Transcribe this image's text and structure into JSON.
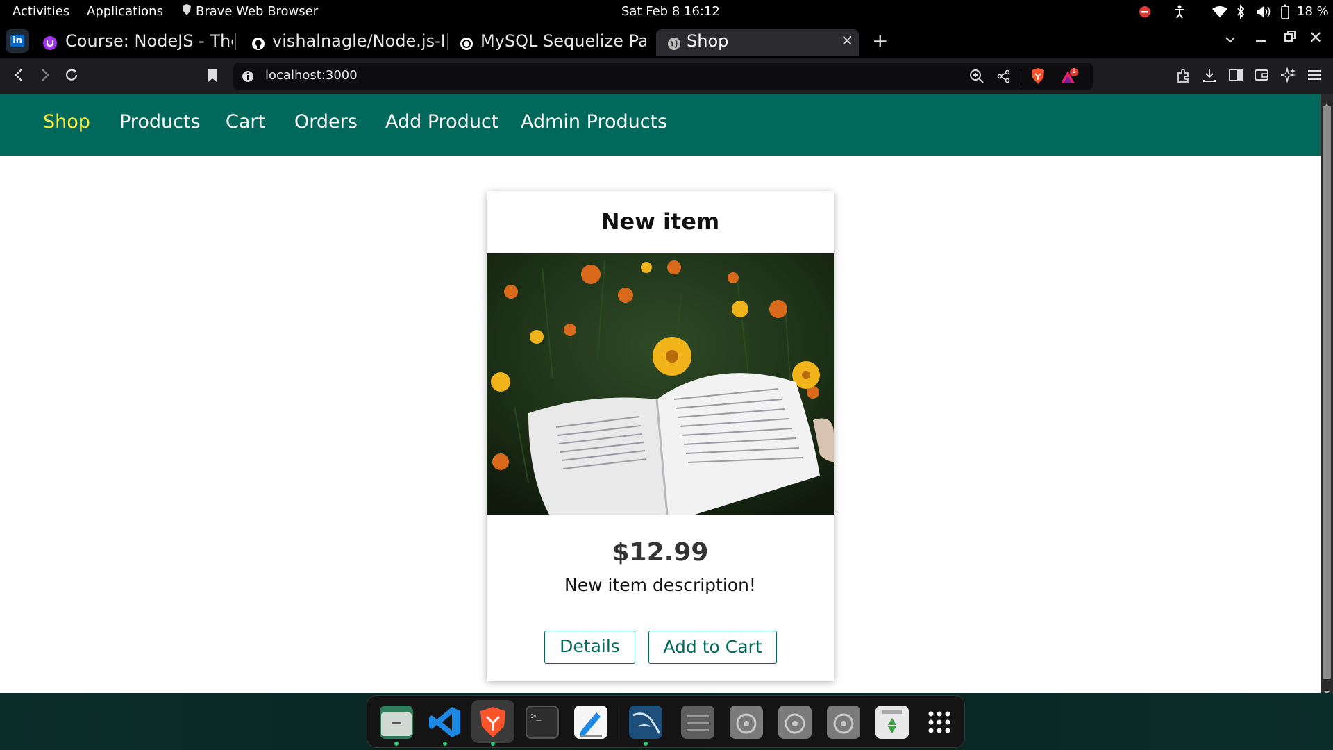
{
  "system_bar": {
    "activities": "Activities",
    "applications": "Applications",
    "active_app": "Brave Web Browser",
    "datetime": "Sat Feb 8  16:12",
    "battery": "18 %"
  },
  "browser": {
    "tabs": [
      {
        "label": "Course: NodeJS - The"
      },
      {
        "label": "vishalnagle/Node.js-M"
      },
      {
        "label": "MySQL Sequelize Pass"
      },
      {
        "label": "Shop"
      }
    ],
    "url": "localhost:3000",
    "notification_count": "1"
  },
  "nav": {
    "links": [
      {
        "label": "Shop",
        "active": true
      },
      {
        "label": "Products"
      },
      {
        "label": "Cart"
      },
      {
        "label": "Orders"
      },
      {
        "label": "Add Product"
      },
      {
        "label": "Admin Products"
      }
    ]
  },
  "product": {
    "title": "New item",
    "price": "$12.99",
    "description": "New item description!",
    "details_label": "Details",
    "add_to_cart_label": "Add to Cart"
  },
  "colors": {
    "nav_bg": "#00695c",
    "nav_active": "#ffeb3b",
    "button_border": "#00695c"
  }
}
